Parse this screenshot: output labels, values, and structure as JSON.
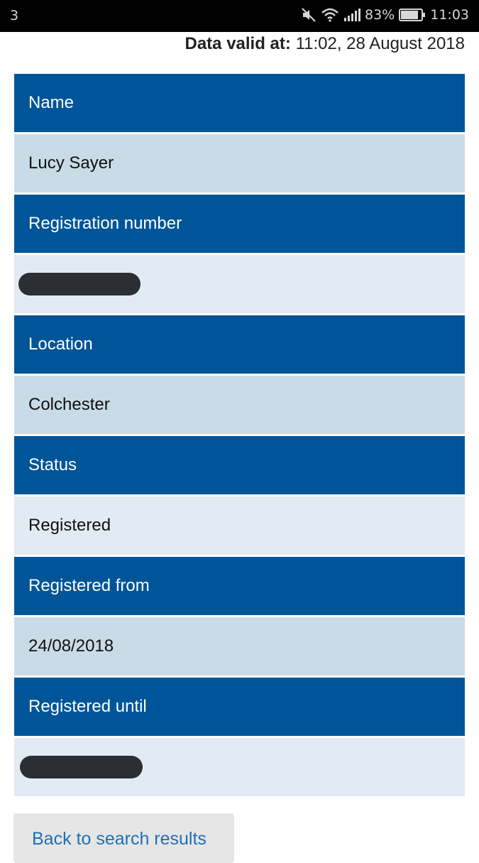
{
  "status_bar": {
    "notification_count": "3",
    "battery_percent": "83%",
    "time": "11:03",
    "icons": [
      "mute-icon",
      "wifi-icon",
      "signal-icon",
      "battery-icon"
    ]
  },
  "header": {
    "valid_label": "Data valid at:",
    "valid_value": "11:02, 28 August 2018"
  },
  "record": [
    {
      "label": "Name",
      "value": "Lucy Sayer",
      "redacted": false
    },
    {
      "label": "Registration number",
      "value": "",
      "redacted": true
    },
    {
      "label": "Location",
      "value": "Colchester",
      "redacted": false
    },
    {
      "label": "Status",
      "value": "Registered",
      "redacted": false
    },
    {
      "label": "Registered from",
      "value": "24/08/2018",
      "redacted": false
    },
    {
      "label": "Registered until",
      "value": "",
      "redacted": true
    }
  ],
  "actions": {
    "back_label": "Back to search results"
  },
  "colors": {
    "header_blue": "#005598",
    "value_light": "#c9dbe7",
    "value_lighter": "#e2ebf3",
    "link_blue": "#1d70b8"
  }
}
